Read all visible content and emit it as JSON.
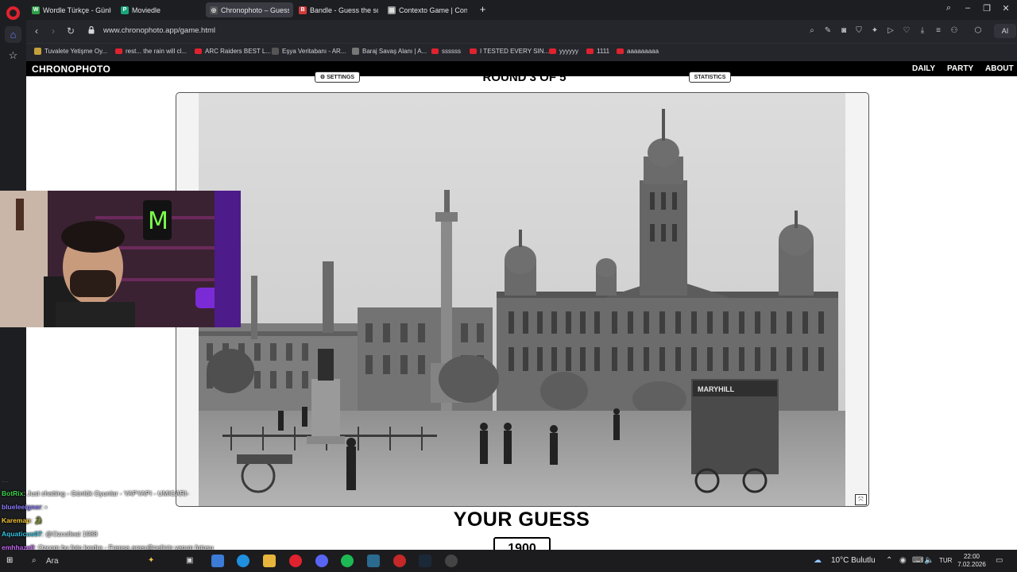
{
  "browser": {
    "tabs": [
      {
        "title": "Wordle Türkçe - Günlük K",
        "icon_letter": "W",
        "color": "#2e9e4a",
        "active": false
      },
      {
        "title": "Moviedle",
        "icon_letter": "P",
        "color": "#18a57b",
        "active": false
      },
      {
        "title": "Chronophoto – Guess the",
        "icon_letter": "◎",
        "color": "#555",
        "active": true
      },
      {
        "title": "Bandle - Guess the song,",
        "icon_letter": "B",
        "color": "#d23b3b",
        "active": false
      },
      {
        "title": "Contexto Game | Contexto",
        "icon_letter": "▤",
        "color": "#9a9a9a",
        "active": false
      }
    ],
    "url": "www.chronophoto.app/game.html",
    "bookmarks": [
      "Tuvalete Yetişme Oy...",
      "rest... the rain will cl...",
      "ARC Raiders BEST L...",
      "Eşya Veritabanı - AR...",
      "Baraj Savaş Alanı | A...",
      "ssssss",
      "I TESTED EVERY SIN...",
      "yyyyyy",
      "1111",
      "aaaaaaaaa"
    ],
    "ai_label": "AI"
  },
  "site": {
    "brand": "CHRONOPHOTO",
    "nav": [
      "DAILY",
      "PARTY",
      "ABOUT"
    ],
    "settings_label": "⚙ SETTINGS",
    "round_label": "ROUND 3 OF 5",
    "stats_label": "STATISTICS",
    "photo_caption": "MARYHILL",
    "guess_title": "YOUR GUESS",
    "guess_value": "1900"
  },
  "chat": [
    {
      "user": "…",
      "text": "",
      "color": "#9a9a9a",
      "faded": true
    },
    {
      "user": "BotRix",
      "text": ": Just chatting - Günlük Oyunlar - YAPYAPI - UMIGARI-",
      "color": "#3fd14a"
    },
    {
      "user": "blueleeigner",
      "text": ": ⬪",
      "color": "#8b7cff"
    },
    {
      "user": "Karemap",
      "text": ": 🐊",
      "color": "#f2c232"
    },
    {
      "user": "Aquaticus07",
      "text": ": @Ozcolleat 1988",
      "color": "#35c3e0"
    },
    {
      "user": "emhhazell",
      "text": ": Ozcom bu foto londra - Fransa arası@nelinin yapım fotosu",
      "color": "#c066f0"
    }
  ],
  "taskbar": {
    "search": "Ara",
    "weather": "10°C  Bulutlu",
    "lang": "TUR",
    "time": "22:00",
    "date": "7.02.2026"
  },
  "colors": {
    "chrome_dark": "#1d1e22",
    "site_header": "#000000",
    "accent_red": "#e0222f"
  }
}
